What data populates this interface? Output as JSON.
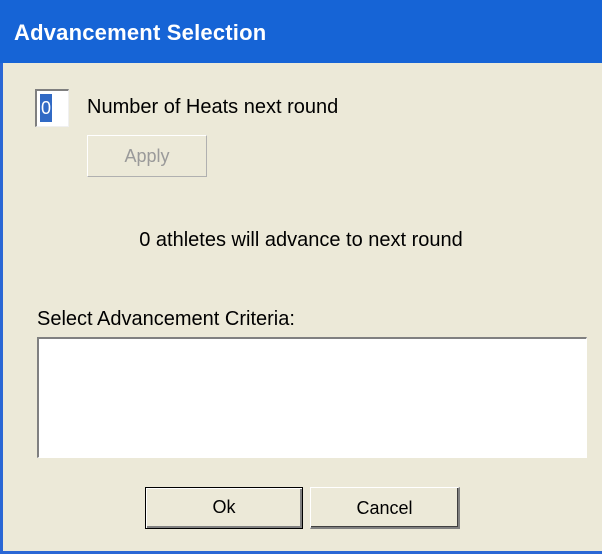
{
  "window": {
    "title": "Advancement Selection"
  },
  "heats": {
    "value": "0",
    "label": "Number of Heats next round"
  },
  "buttons": {
    "apply": "Apply",
    "ok": "Ok",
    "cancel": "Cancel"
  },
  "status": {
    "advance_text": "0 athletes will advance to next round"
  },
  "criteria": {
    "label": "Select Advancement Criteria:",
    "items": []
  },
  "colors": {
    "titlebar": "#1664d6",
    "dialog_bg": "#ece9d8",
    "selection": "#316ac5"
  }
}
